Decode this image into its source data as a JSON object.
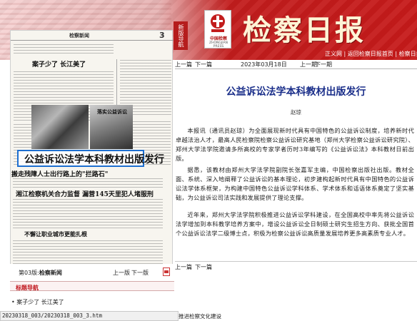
{
  "header": {
    "masthead": "检察日报",
    "logo_cn": "中国检察",
    "logo_en": "ZHONGJIAN PRESS",
    "side_tab": "新版导航",
    "links": [
      "正义网",
      "返回检察日报首页",
      "检察日报电子版"
    ],
    "colors": {
      "brand_red": "#c61a1a",
      "title_blue": "#1b2f8a"
    }
  },
  "paper_thumb": {
    "section_name": "检察新闻",
    "page_number": "3",
    "headline_1": "案子少了 长江美了",
    "highlight_headline": "公益诉讼法学本科教材出版发行",
    "headline_2": "搬走残障人士出行路上的\"拦路石\"",
    "headline_3": "湘江检察机关合力监督 漏营145天里犯人堵服刑",
    "headline_4": "不懈让职业城市更能扎根",
    "headline_5": "落实公益诉讼"
  },
  "edition": {
    "label_prefix": "第03版:",
    "label_name": "检察新闻",
    "prev": "上一版",
    "next": "下一版",
    "pdf_icon": "pdf-icon"
  },
  "nav": {
    "title": "标题导航",
    "items": [
      "案子少了 长江美了"
    ]
  },
  "status_bar": {
    "url": "20230318_003/20230318_003_3.htm",
    "suffix": "推进检察文化建设"
  },
  "article_nav": {
    "prev": "上一篇",
    "next": "下一篇",
    "date": "2023年03月18日",
    "ed_prev": "上一期",
    "ed_next": "下一期"
  },
  "article": {
    "title": "公益诉讼法学本科教材出版发行",
    "author": "赵琼",
    "paragraphs": [
      "本报讯（通讯员赵琼）为全面展现新时代具有中国特色的公益诉讼制度，培养新时代卓越法治人才，最高人民检察院检察公益诉讼研究基地（郑州大学检察公益诉讼研究院）、郑州大学法学院邀请多所高校的专家学者历时3年编写的《公益诉讼法》本科教材日前出版。",
      "据悉，该教材由郑州大学法学院副院长张嘉军主编，中国检察出版社出版。教材全面、系统、深入地阐释了公益诉讼的基本理论，初步建构起新时代具有中国特色的公益诉讼法学体系框架，为构建中国特色公益诉讼学科体系、学术体系和话语体系奠定了坚实基础，为公益诉讼司法实践和发展提供了理论支撑。",
      "近年来，郑州大学法学院积极推进公益诉讼学科建设，在全国高校中率先将公益诉讼法学增加到本科教学培养方案中，增设公益诉讼全日制硕士研究生招生方向、获批全国首个公益诉讼法学二级博士点，积极为检察公益诉讼高质量发展培养更多高素质专业人才。"
    ]
  }
}
